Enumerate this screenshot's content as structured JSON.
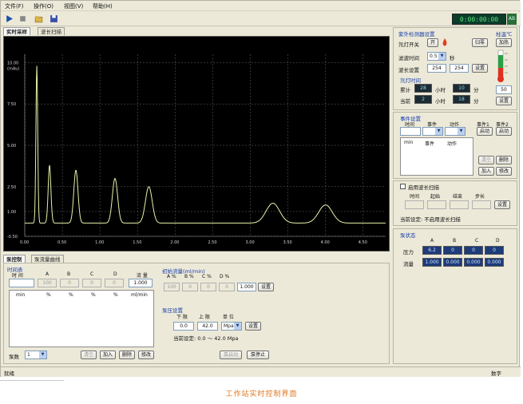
{
  "menu": [
    "文件(F)",
    "操作(O)",
    "视图(V)",
    "帮助(H)"
  ],
  "toolbar": {
    "icons": [
      "play-icon",
      "stop-icon",
      "open-file-icon",
      "save-icon"
    ]
  },
  "clock": "0:00:00:00",
  "clock_badge": "AB",
  "top_tabs": [
    "实时采样",
    "波长扫描"
  ],
  "chart_data": {
    "type": "line",
    "ylabel": "(mAu)",
    "y_ticks": [
      "10.00",
      "7.50",
      "5.00",
      "2.50",
      "1.00",
      "-0.50"
    ],
    "y_tick_values": [
      10.0,
      7.5,
      5.0,
      2.5,
      1.0,
      -0.5
    ],
    "x_ticks": [
      "0.00",
      "0.50",
      "1.00",
      "1.50",
      "2.00",
      "2.50",
      "3.00",
      "3.50",
      "4.00",
      "4.50"
    ],
    "xlim": [
      0,
      4.8
    ],
    "ylim": [
      -0.5,
      10.5
    ],
    "grid": true,
    "line_color": "#e8f0a8",
    "peaks": [
      {
        "x": 0.16,
        "y": 9.5,
        "w": 0.012
      },
      {
        "x": 0.33,
        "y": 3.5,
        "w": 0.018
      },
      {
        "x": 0.68,
        "y": 3.2,
        "w": 0.028
      },
      {
        "x": 1.2,
        "y": 2.7,
        "w": 0.035
      },
      {
        "x": 1.65,
        "y": 2.2,
        "w": 0.045
      },
      {
        "x": 3.3,
        "y": 1.2,
        "w": 0.09
      },
      {
        "x": 4.0,
        "y": 1.1,
        "w": 0.09
      }
    ]
  },
  "pump_tabs": [
    "泵控制",
    "泵流量曲线"
  ],
  "time_table": {
    "title": "时间表",
    "headers": [
      "时 间",
      "A",
      "B",
      "C",
      "D",
      "流 量"
    ],
    "inputs": [
      "",
      "100",
      "0",
      "0",
      "0",
      "1.000"
    ],
    "list_headers": [
      "min",
      "%",
      "%",
      "%",
      "%",
      "ml/min"
    ]
  },
  "initial_flow": {
    "title": "初始流量(ml/min)",
    "headers": [
      "A %",
      "B %",
      "C %",
      "D %"
    ],
    "values": [
      "100",
      "0",
      "0",
      "0",
      "1.000"
    ],
    "set_label": "设置"
  },
  "pressure": {
    "title": "泵压设置",
    "headers": [
      "下 限",
      "上 限",
      "单 位"
    ],
    "lower": "0.0",
    "upper": "42.0",
    "unit": "Mpa",
    "set_label": "设置",
    "current": "当前设定: 0.0 ～ 42.0 Mpa"
  },
  "pump_controls": {
    "label": "泵数",
    "value": "1",
    "clear": "清空",
    "add": "加入",
    "delete": "删除",
    "modify": "修改",
    "start": "泵启动",
    "stop": "泵停止"
  },
  "uv_detector": {
    "title": "紫外检测器设置",
    "temp_title": "柱温℃",
    "lamp_label": "氘灯开关",
    "lamp_state": "开",
    "zero": "归零",
    "heat": "加热",
    "filter_label": "滤波时间",
    "filter_value": "0.5",
    "filter_unit": "秒",
    "wave_label": "波长设置",
    "wave1": "254",
    "wave2": "254",
    "set_label": "设置",
    "lamp_time_title": "氘灯时间",
    "total_label": "累计",
    "total_hours": "28",
    "total_minutes": "10",
    "current_label": "当前",
    "current_hours": "2",
    "current_minutes": "18",
    "hours_unit": "小时",
    "minutes_unit": "分",
    "temp_value": "50",
    "temp_set": "设置"
  },
  "events": {
    "title": "事件设置",
    "headers": [
      "时间",
      "事件",
      "动作"
    ],
    "event1": "事件1",
    "event2": "事件2",
    "start1": "启动",
    "start2": "启动",
    "list_headers": [
      "min",
      "事件",
      "动作"
    ],
    "clear": "清空",
    "delete": "删除",
    "add": "加入",
    "modify": "修改"
  },
  "wave_scan": {
    "checkbox": "启用波长扫描",
    "headers": [
      "时间",
      "起始",
      "结束",
      "步长"
    ],
    "set_label": "设置",
    "current": "当前设定:  不启用波长扫描"
  },
  "pump_status": {
    "title": "泵状态",
    "headers": [
      "A",
      "B",
      "C",
      "D"
    ],
    "pressure_label": "压力",
    "pressure": [
      "6.2",
      "0",
      "0",
      "0"
    ],
    "flow_label": "流量",
    "flow": [
      "1.000",
      "0.000",
      "0.000",
      "0.000"
    ]
  },
  "status": {
    "left": "就绪",
    "right": "数字"
  },
  "caption": "工作站实时控制界面"
}
